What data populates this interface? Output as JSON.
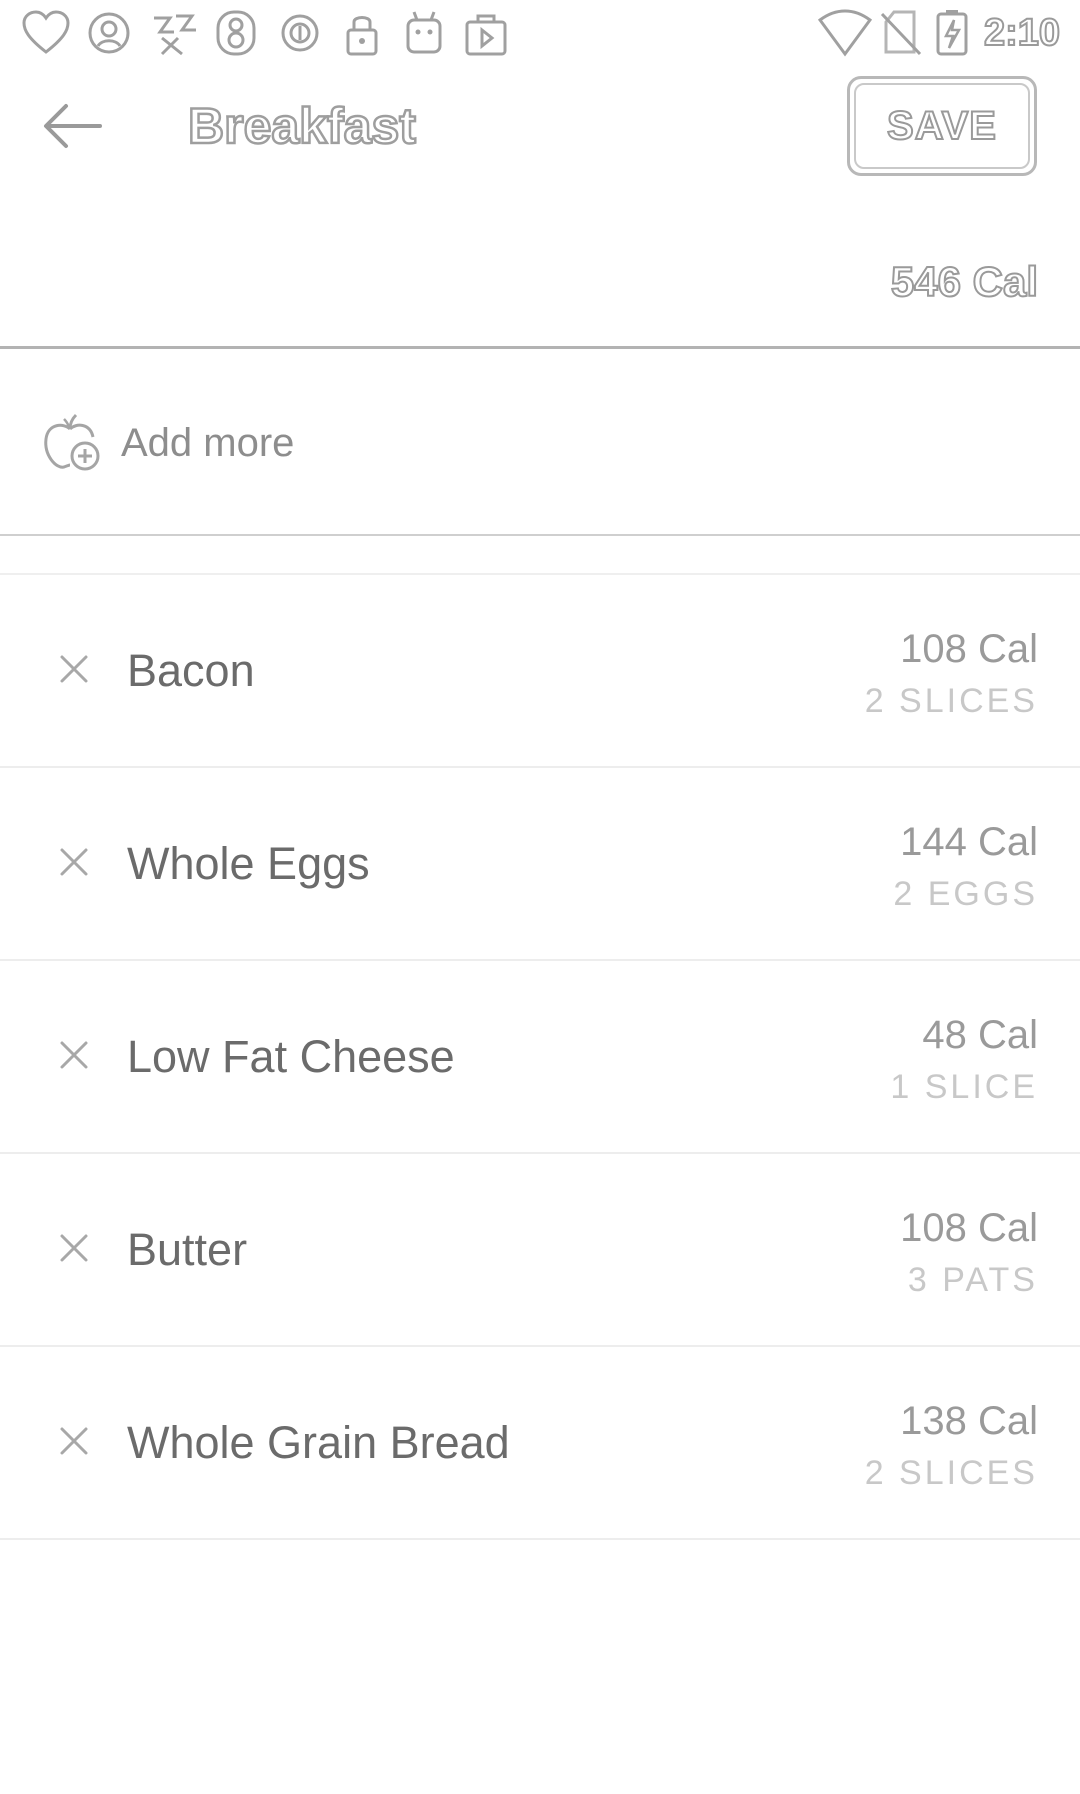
{
  "status_bar": {
    "time": "2:10",
    "left_icons": [
      "heart-icon",
      "face-icon",
      "sticker-icon",
      "eight-icon",
      "circle-icon",
      "lock-icon",
      "android-icon",
      "bag-icon"
    ],
    "right_icons": [
      "wifi-icon",
      "no-sim-icon",
      "battery-charging-icon"
    ]
  },
  "toolbar": {
    "title": "Breakfast",
    "save_label": "SAVE"
  },
  "summary": {
    "total_calories": "546 Cal"
  },
  "add_more": {
    "label": "Add more"
  },
  "foods": [
    {
      "name": "Bacon",
      "calories": "108 Cal",
      "quantity": "2 SLICES"
    },
    {
      "name": "Whole Eggs",
      "calories": "144 Cal",
      "quantity": "2 EGGS"
    },
    {
      "name": "Low Fat Cheese",
      "calories": "48 Cal",
      "quantity": "1 SLICE"
    },
    {
      "name": "Butter",
      "calories": "108 Cal",
      "quantity": "3 PATS"
    },
    {
      "name": "Whole Grain Bread",
      "calories": "138 Cal",
      "quantity": "2 SLICES"
    }
  ],
  "colors": {
    "background": "#ffffff",
    "text_primary": "#6b6b6b",
    "text_secondary": "#9a9a9a",
    "divider": "#b3b3b3"
  }
}
